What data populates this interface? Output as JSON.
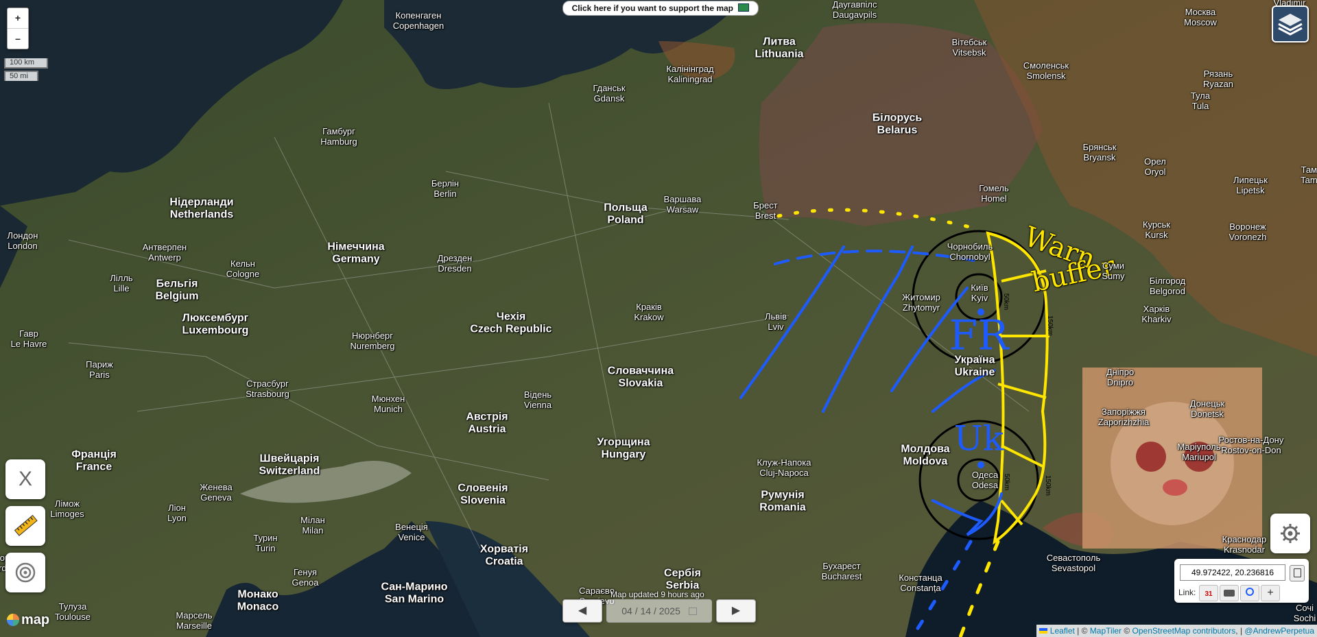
{
  "banner": {
    "support_text": "Click here if you want to support the map"
  },
  "zoom": {
    "in_label": "+",
    "out_label": "–"
  },
  "scale": {
    "km": "100 km",
    "mi": "50 mi"
  },
  "tools": {
    "x_label": "X"
  },
  "update": {
    "text": "Map updated 9 hours ago",
    "date": "04 / 14 / 2025"
  },
  "coords": {
    "value": "49.972422, 20.236816",
    "link_label": "Link:",
    "calendar_day": "31"
  },
  "attribution": {
    "leaflet": "Leaflet",
    "sep1": " | © ",
    "maptiler": "MapTiler",
    "sep2": " © ",
    "osm": "OpenStreetMap contributors",
    "sep3": ", | ",
    "author": "@AndrewPerpetua"
  },
  "logo": {
    "text": "map"
  },
  "annotations": {
    "warn": "Warn",
    "buffer": "buffer",
    "fr": "FR",
    "uk": "Uk",
    "r50a": "50km",
    "r150": "150km",
    "r50b": "50km",
    "r150b": "150km"
  },
  "cities": [
    {
      "id": "copenhagen",
      "l1": "Копенгаген",
      "l2": "Copenhagen",
      "cls": "small"
    },
    {
      "id": "daugavpils",
      "l1": "Даугавпілс",
      "l2": "Daugavpils",
      "cls": "small"
    },
    {
      "id": "moscow",
      "l1": "Москва",
      "l2": "Moscow",
      "cls": "small"
    },
    {
      "id": "vladimir",
      "l1": "Vladimir",
      "l2": "",
      "cls": "small"
    },
    {
      "id": "lithuania",
      "l1": "Литва",
      "l2": "Lithuania",
      "cls": "country"
    },
    {
      "id": "kaliningrad",
      "l1": "Калінінград",
      "l2": "Kaliningrad",
      "cls": "small"
    },
    {
      "id": "vitebsk",
      "l1": "Вітебськ",
      "l2": "Vitsebsk",
      "cls": "small"
    },
    {
      "id": "smolensk",
      "l1": "Смоленськ",
      "l2": "Smolensk",
      "cls": "small"
    },
    {
      "id": "ryazan",
      "l1": "Рязань",
      "l2": "Ryazan",
      "cls": "small"
    },
    {
      "id": "gdansk",
      "l1": "Гданськ",
      "l2": "Gdansk",
      "cls": "small"
    },
    {
      "id": "tula",
      "l1": "Тула",
      "l2": "Tula",
      "cls": "small"
    },
    {
      "id": "belarus",
      "l1": "Білорусь",
      "l2": "Belarus",
      "cls": "country"
    },
    {
      "id": "hamburg",
      "l1": "Гамбург",
      "l2": "Hamburg",
      "cls": "small"
    },
    {
      "id": "bryansk",
      "l1": "Брянськ",
      "l2": "Bryansk",
      "cls": "small"
    },
    {
      "id": "orel",
      "l1": "Орел",
      "l2": "Oryol",
      "cls": "small"
    },
    {
      "id": "berlin",
      "l1": "Берлін",
      "l2": "Berlin",
      "cls": "small"
    },
    {
      "id": "lipetsk",
      "l1": "Липецьк",
      "l2": "Lipetsk",
      "cls": "small"
    },
    {
      "id": "gomel",
      "l1": "Гомель",
      "l2": "Homel",
      "cls": "small"
    },
    {
      "id": "netherlands",
      "l1": "Нідерланди",
      "l2": "Netherlands",
      "cls": "country"
    },
    {
      "id": "poland",
      "l1": "Польща",
      "l2": "Poland",
      "cls": "country"
    },
    {
      "id": "warsaw",
      "l1": "Варшава",
      "l2": "Warsaw",
      "cls": "small"
    },
    {
      "id": "brest",
      "l1": "Брест",
      "l2": "Brest",
      "cls": "small"
    },
    {
      "id": "london",
      "l1": "Лондон",
      "l2": "London",
      "cls": "small"
    },
    {
      "id": "kursk",
      "l1": "Курськ",
      "l2": "Kursk",
      "cls": "small"
    },
    {
      "id": "voronezh",
      "l1": "Воронеж",
      "l2": "Voronezh",
      "cls": "small"
    },
    {
      "id": "antwerp",
      "l1": "Антверпен",
      "l2": "Antwerp",
      "cls": "small"
    },
    {
      "id": "germany",
      "l1": "Німеччина",
      "l2": "Germany",
      "cls": "country"
    },
    {
      "id": "chornobyl",
      "l1": "Чорнобиль",
      "l2": "Chornobyl",
      "cls": "small"
    },
    {
      "id": "sumy",
      "l1": "Суми",
      "l2": "Sumy",
      "cls": "small"
    },
    {
      "id": "dresden",
      "l1": "Дрезден",
      "l2": "Dresden",
      "cls": "small"
    },
    {
      "id": "cologne",
      "l1": "Кельн",
      "l2": "Cologne",
      "cls": "small"
    },
    {
      "id": "lille",
      "l1": "Лілль",
      "l2": "Lille",
      "cls": "small"
    },
    {
      "id": "belgium",
      "l1": "Бельгія",
      "l2": "Belgium",
      "cls": "country"
    },
    {
      "id": "kyiv",
      "l1": "Київ",
      "l2": "Kyiv",
      "cls": "small"
    },
    {
      "id": "belgorod",
      "l1": "Білгород",
      "l2": "Belgorod",
      "cls": "small"
    },
    {
      "id": "zhytomyr",
      "l1": "Житомир",
      "l2": "Zhytomyr",
      "cls": "small"
    },
    {
      "id": "kharkiv",
      "l1": "Харків",
      "l2": "Kharkiv",
      "cls": "small"
    },
    {
      "id": "luxembourg",
      "l1": "Люксембург",
      "l2": "Luxembourg",
      "cls": "country"
    },
    {
      "id": "lviv",
      "l1": "Львів",
      "l2": "Lviv",
      "cls": "small"
    },
    {
      "id": "krakow",
      "l1": "Краків",
      "l2": "Krakow",
      "cls": "small"
    },
    {
      "id": "czech",
      "l1": "Чехія",
      "l2": "Czech Republic",
      "cls": "country"
    },
    {
      "id": "havre",
      "l1": "Гавр",
      "l2": "Le Havre",
      "cls": "small"
    },
    {
      "id": "nuremberg",
      "l1": "Нюрнберг",
      "l2": "Nuremberg",
      "cls": "small"
    },
    {
      "id": "paris",
      "l1": "Париж",
      "l2": "Paris",
      "cls": "small"
    },
    {
      "id": "ukraine",
      "l1": "Україна",
      "l2": "Ukraine",
      "cls": "country"
    },
    {
      "id": "slovakia",
      "l1": "Словаччина",
      "l2": "Slovakia",
      "cls": "country"
    },
    {
      "id": "dnipro",
      "l1": "Дніпро",
      "l2": "Dnipro",
      "cls": "small"
    },
    {
      "id": "strasbourg",
      "l1": "Страсбург",
      "l2": "Strasbourg",
      "cls": "small"
    },
    {
      "id": "vienna",
      "l1": "Відень",
      "l2": "Vienna",
      "cls": "small"
    },
    {
      "id": "munich",
      "l1": "Мюнхен",
      "l2": "Munich",
      "cls": "small"
    },
    {
      "id": "donetsk",
      "l1": "Донецьк",
      "l2": "Donetsk",
      "cls": "small"
    },
    {
      "id": "zaporizhzhia",
      "l1": "Запоріжжя",
      "l2": "Zaporizhzhia",
      "cls": "small"
    },
    {
      "id": "austria",
      "l1": "Австрія",
      "l2": "Austria",
      "cls": "country"
    },
    {
      "id": "rostov",
      "l1": "Ростов-на-Дону",
      "l2": "Rostov-on-Don",
      "cls": "small"
    },
    {
      "id": "hungary",
      "l1": "Угорщина",
      "l2": "Hungary",
      "cls": "country"
    },
    {
      "id": "moldova",
      "l1": "Молдова",
      "l2": "Moldova",
      "cls": "country"
    },
    {
      "id": "france",
      "l1": "Франція",
      "l2": "France",
      "cls": "country"
    },
    {
      "id": "switzerland",
      "l1": "Швейцарія",
      "l2": "Switzerland",
      "cls": "country"
    },
    {
      "id": "mariupol",
      "l1": "Маріуполь",
      "l2": "Mariupol",
      "cls": "small"
    },
    {
      "id": "cluj",
      "l1": "Клуж-Напока",
      "l2": "Cluj-Napoca",
      "cls": "small"
    },
    {
      "id": "odesa",
      "l1": "Одеса",
      "l2": "Odesa",
      "cls": "small"
    },
    {
      "id": "geneva",
      "l1": "Женева",
      "l2": "Geneva",
      "cls": "small"
    },
    {
      "id": "slovenia",
      "l1": "Словенія",
      "l2": "Slovenia",
      "cls": "country"
    },
    {
      "id": "romania",
      "l1": "Румунія",
      "l2": "Romania",
      "cls": "country"
    },
    {
      "id": "limoges",
      "l1": "Лімож",
      "l2": "Limoges",
      "cls": "small"
    },
    {
      "id": "lyon",
      "l1": "Ліон",
      "l2": "Lyon",
      "cls": "small"
    },
    {
      "id": "milan",
      "l1": "Мілан",
      "l2": "Milan",
      "cls": "small"
    },
    {
      "id": "venice",
      "l1": "Венеція",
      "l2": "Venice",
      "cls": "small"
    },
    {
      "id": "turin",
      "l1": "Турин",
      "l2": "Turin",
      "cls": "small"
    },
    {
      "id": "krasnodar",
      "l1": "Краснодар",
      "l2": "Krasnodar",
      "cls": "small"
    },
    {
      "id": "croatia",
      "l1": "Хорватія",
      "l2": "Croatia",
      "cls": "country"
    },
    {
      "id": "sevastopol",
      "l1": "Севастополь",
      "l2": "Sevastopol",
      "cls": "small"
    },
    {
      "id": "bordeaux",
      "l1": "Бордо",
      "l2": "Bordeaux",
      "cls": "small"
    },
    {
      "id": "bucharest",
      "l1": "Бухарест",
      "l2": "Bucharest",
      "cls": "small"
    },
    {
      "id": "genoa",
      "l1": "Генуя",
      "l2": "Genoa",
      "cls": "small"
    },
    {
      "id": "constanta",
      "l1": "Констанца",
      "l2": "Constanța",
      "cls": "small"
    },
    {
      "id": "serbia",
      "l1": "Сербія",
      "l2": "Serbia",
      "cls": "country"
    },
    {
      "id": "sarajevo",
      "l1": "Сараєво",
      "l2": "Sarajevo",
      "cls": "small"
    },
    {
      "id": "sanmarino",
      "l1": "Сан-Марино",
      "l2": "San Marino",
      "cls": "country"
    },
    {
      "id": "monaco",
      "l1": "Монако",
      "l2": "Monaco",
      "cls": "country"
    },
    {
      "id": "toulouse",
      "l1": "Тулуза",
      "l2": "Toulouse",
      "cls": "small"
    },
    {
      "id": "marseille",
      "l1": "Марсель",
      "l2": "Marseille",
      "cls": "small"
    },
    {
      "id": "sochi",
      "l1": "Сочі",
      "l2": "Sochi",
      "cls": "small"
    },
    {
      "id": "tambov",
      "l1": "Тамб",
      "l2": "Tamb",
      "cls": "small"
    }
  ],
  "colors": {
    "sea": "#14212e",
    "land": "#3d4a2e",
    "belarus_tint": "#6b4a40",
    "russia_tint": "#7a4f38",
    "annotation_blue": "#1e5bff",
    "annotation_yellow": "#ffe600",
    "ring_black": "#000000"
  }
}
